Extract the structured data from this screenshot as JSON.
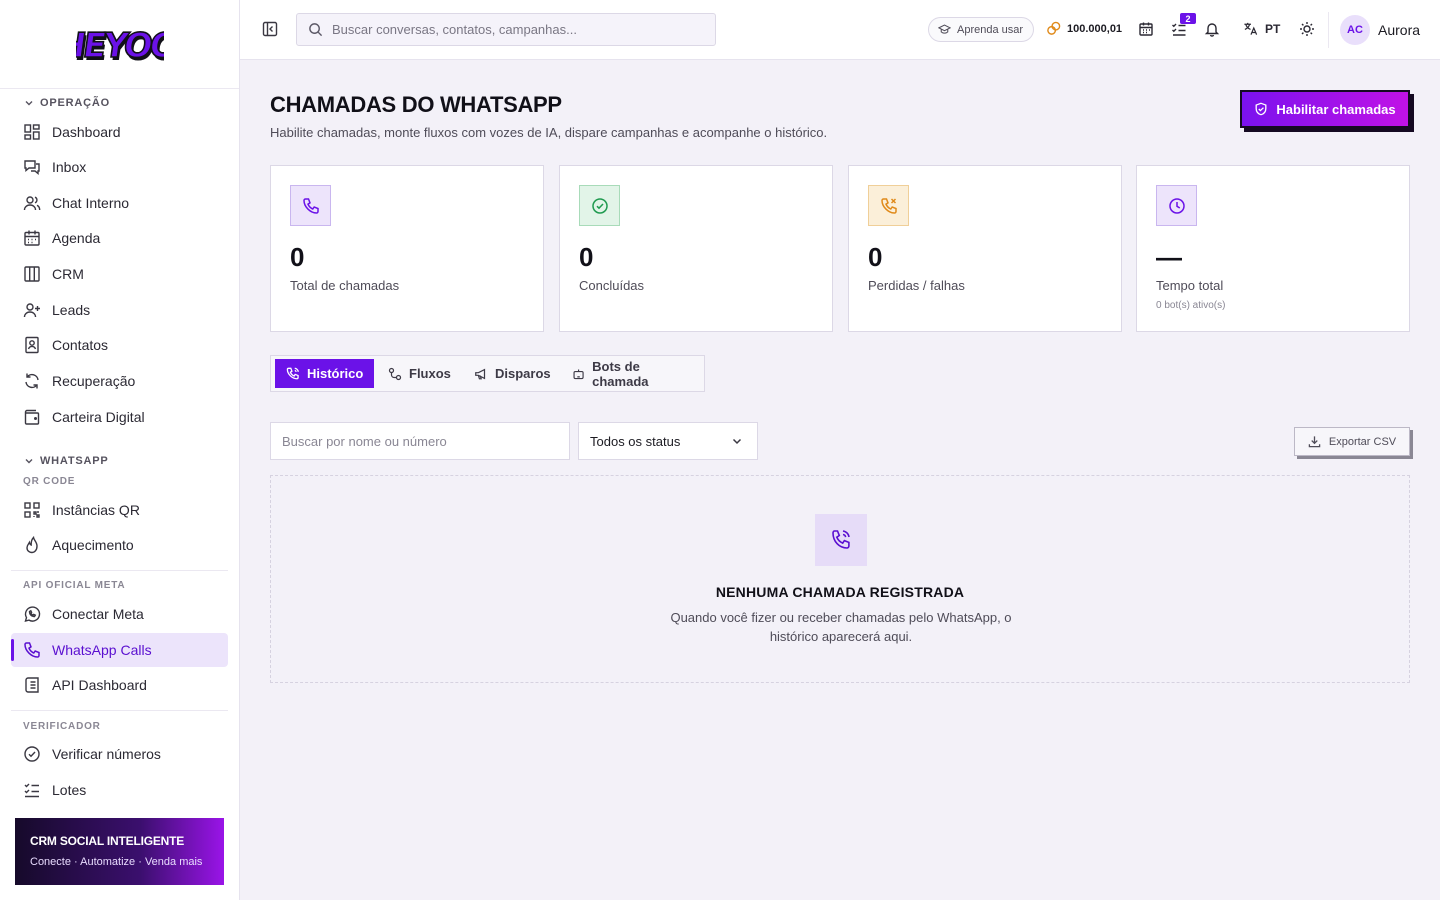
{
  "brand": {
    "logo_text": "HEYOO",
    "logo_fill": "#6b12e8",
    "logo_outline": "#111018"
  },
  "sidebar": {
    "section_operacao": "OPERAÇÃO",
    "operacao_items": [
      "Dashboard",
      "Inbox",
      "Chat Interno",
      "Agenda",
      "CRM",
      "Leads",
      "Contatos",
      "Recuperação",
      "Carteira Digital"
    ],
    "section_whatsapp": "WHATSAPP",
    "sub_qr": "QR CODE",
    "qr_items": [
      "Instâncias QR",
      "Aquecimento"
    ],
    "sub_api": "API OFICIAL META",
    "api_items": [
      "Conectar Meta",
      "WhatsApp Calls",
      "API Dashboard"
    ],
    "sub_verificador": "VERIFICADOR",
    "verificador_items": [
      "Verificar números",
      "Lotes"
    ],
    "active_item": "WhatsApp Calls",
    "promo_title": "CRM SOCIAL INTELIGENTE",
    "promo_sub": "Conecte · Automatize · Venda mais"
  },
  "topbar": {
    "search_placeholder": "Buscar conversas, contatos, campanhas...",
    "learn_label": "Aprenda usar",
    "credits": "100.000,01",
    "tasks_badge": "2",
    "language": "PT",
    "avatar_initials": "AC",
    "user_name": "Aurora"
  },
  "page": {
    "title": "CHAMADAS DO WHATSAPP",
    "subtitle": "Habilite chamadas, monte fluxos com vozes de IA, dispare campanhas e acompanhe o histórico.",
    "enable_button": "Habilitar chamadas"
  },
  "stats": [
    {
      "value": "0",
      "label": "Total de chamadas",
      "extra": ""
    },
    {
      "value": "0",
      "label": "Concluídas",
      "extra": ""
    },
    {
      "value": "0",
      "label": "Perdidas / falhas",
      "extra": ""
    },
    {
      "value": "—",
      "label": "Tempo total",
      "extra": "0 bot(s) ativo(s)"
    }
  ],
  "tabs": [
    "Histórico",
    "Fluxos",
    "Disparos",
    "Bots de chamada"
  ],
  "filters": {
    "search_placeholder": "Buscar por nome ou número",
    "status_selected": "Todos os status",
    "export_label": "Exportar CSV"
  },
  "empty_state": {
    "title": "NENHUMA CHAMADA REGISTRADA",
    "message": "Quando você fizer ou receber chamadas pelo WhatsApp, o histórico aparecerá aqui."
  },
  "colors": {
    "accent": "#6b12e8",
    "accent_gradient_end": "#c112e6",
    "success": "#1f9a4f",
    "warning": "#e08a1a"
  }
}
